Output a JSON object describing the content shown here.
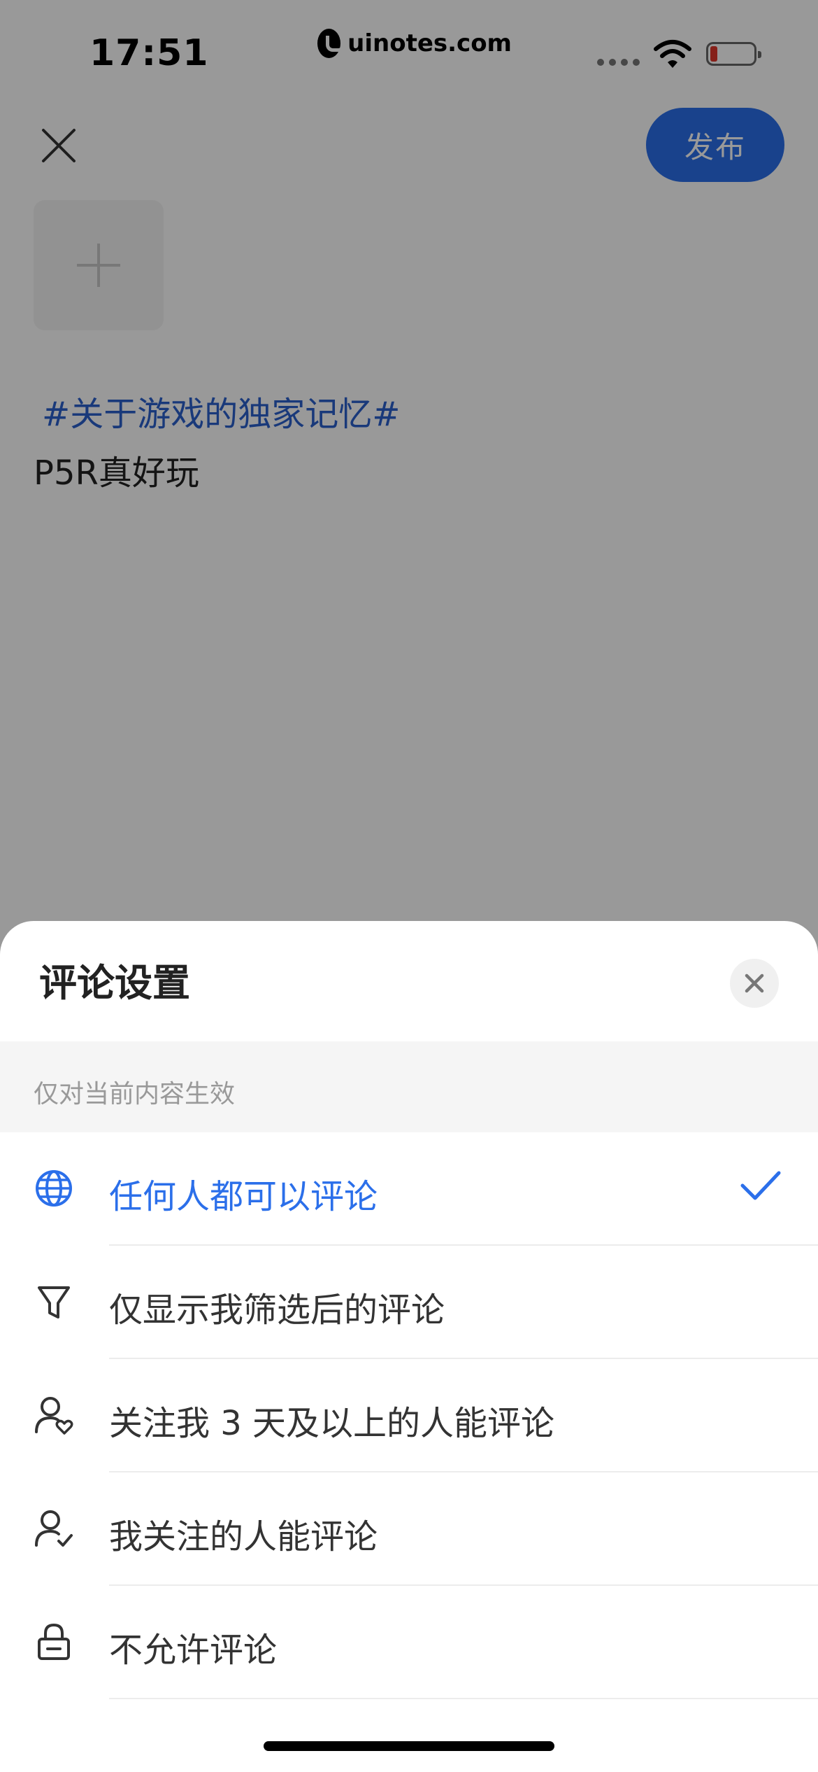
{
  "status_bar": {
    "time": "17:51",
    "watermark": "uinotes.com",
    "icons": [
      "cellular-signal-icon",
      "wifi-icon",
      "battery-icon"
    ]
  },
  "editor": {
    "publish_label": "发布",
    "topic": "#关于游戏的独家记忆#",
    "text": "P5R真好玩",
    "icons": [
      "close-icon",
      "add-image-icon"
    ]
  },
  "sheet": {
    "title": "评论设置",
    "subtitle": "仅对当前内容生效",
    "options": [
      {
        "label": "任何人都可以评论",
        "icon": "globe-icon",
        "selected": true
      },
      {
        "label": "仅显示我筛选后的评论",
        "icon": "filter-icon",
        "selected": false
      },
      {
        "label": "关注我 3 天及以上的人能评论",
        "icon": "user-heart-icon",
        "selected": false
      },
      {
        "label": "我关注的人能评论",
        "icon": "user-check-icon",
        "selected": false
      },
      {
        "label": "不允许评论",
        "icon": "lock-icon",
        "selected": false
      }
    ]
  },
  "colors": {
    "accent": "#2b6fea",
    "topic": "#2b5fcc",
    "overlay": "rgba(0,0,0,0.40)"
  }
}
